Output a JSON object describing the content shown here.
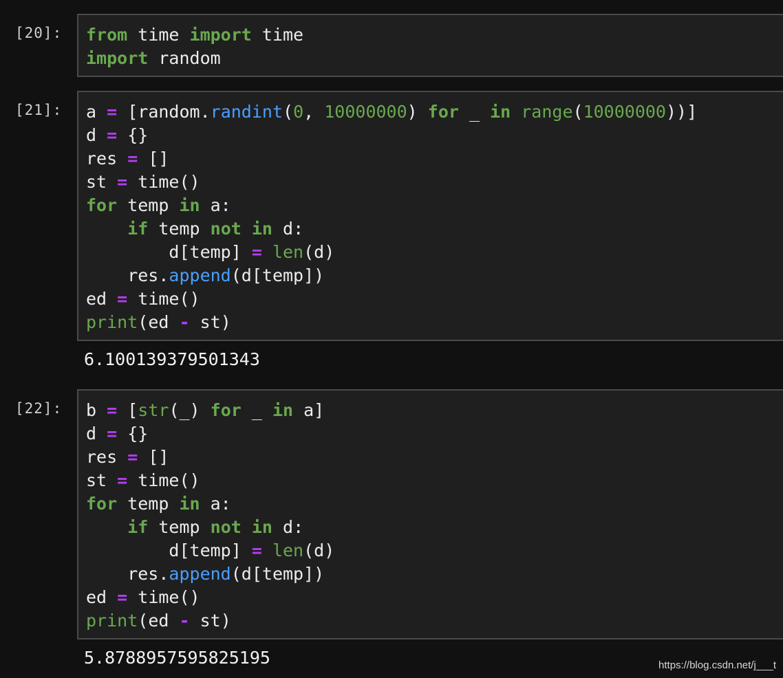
{
  "cells": [
    {
      "prompt": "[20]:",
      "lines": [
        [
          [
            "kw",
            "from"
          ],
          [
            "pl",
            " time "
          ],
          [
            "kw",
            "import"
          ],
          [
            "pl",
            " time"
          ]
        ],
        [
          [
            "kw",
            "import"
          ],
          [
            "pl",
            " random"
          ]
        ]
      ],
      "output": ""
    },
    {
      "prompt": "[21]:",
      "lines": [
        [
          [
            "pl",
            "a "
          ],
          [
            "op",
            "="
          ],
          [
            "pl",
            " [random."
          ],
          [
            "fn",
            "randint"
          ],
          [
            "pl",
            "("
          ],
          [
            "num",
            "0"
          ],
          [
            "pl",
            ", "
          ],
          [
            "num",
            "10000000"
          ],
          [
            "pl",
            ") "
          ],
          [
            "kw",
            "for"
          ],
          [
            "pl",
            " _ "
          ],
          [
            "kw",
            "in"
          ],
          [
            "pl",
            " "
          ],
          [
            "bi",
            "range"
          ],
          [
            "pl",
            "("
          ],
          [
            "num",
            "10000000"
          ],
          [
            "pl",
            "))]"
          ]
        ],
        [
          [
            "pl",
            "d "
          ],
          [
            "op",
            "="
          ],
          [
            "pl",
            " {}"
          ]
        ],
        [
          [
            "pl",
            "res "
          ],
          [
            "op",
            "="
          ],
          [
            "pl",
            " []"
          ]
        ],
        [
          [
            "pl",
            "st "
          ],
          [
            "op",
            "="
          ],
          [
            "pl",
            " time()"
          ]
        ],
        [
          [
            "kw",
            "for"
          ],
          [
            "pl",
            " temp "
          ],
          [
            "kw",
            "in"
          ],
          [
            "pl",
            " a:"
          ]
        ],
        [
          [
            "pl",
            "    "
          ],
          [
            "kw",
            "if"
          ],
          [
            "pl",
            " temp "
          ],
          [
            "kw",
            "not"
          ],
          [
            "pl",
            " "
          ],
          [
            "kw",
            "in"
          ],
          [
            "pl",
            " d:"
          ]
        ],
        [
          [
            "pl",
            "        d[temp] "
          ],
          [
            "op",
            "="
          ],
          [
            "pl",
            " "
          ],
          [
            "bi",
            "len"
          ],
          [
            "pl",
            "(d)"
          ]
        ],
        [
          [
            "pl",
            "    res."
          ],
          [
            "fn",
            "append"
          ],
          [
            "pl",
            "(d[temp])"
          ]
        ],
        [
          [
            "pl",
            "ed "
          ],
          [
            "op",
            "="
          ],
          [
            "pl",
            " time()"
          ]
        ],
        [
          [
            "bi",
            "print"
          ],
          [
            "pl",
            "(ed "
          ],
          [
            "op",
            "-"
          ],
          [
            "pl",
            " st)"
          ]
        ]
      ],
      "output": "6.100139379501343"
    },
    {
      "prompt": "[22]:",
      "lines": [
        [
          [
            "pl",
            "b "
          ],
          [
            "op",
            "="
          ],
          [
            "pl",
            " ["
          ],
          [
            "bi",
            "str"
          ],
          [
            "pl",
            "(_) "
          ],
          [
            "kw",
            "for"
          ],
          [
            "pl",
            " _ "
          ],
          [
            "kw",
            "in"
          ],
          [
            "pl",
            " a]"
          ]
        ],
        [
          [
            "pl",
            "d "
          ],
          [
            "op",
            "="
          ],
          [
            "pl",
            " {}"
          ]
        ],
        [
          [
            "pl",
            "res "
          ],
          [
            "op",
            "="
          ],
          [
            "pl",
            " []"
          ]
        ],
        [
          [
            "pl",
            "st "
          ],
          [
            "op",
            "="
          ],
          [
            "pl",
            " time()"
          ]
        ],
        [
          [
            "kw",
            "for"
          ],
          [
            "pl",
            " temp "
          ],
          [
            "kw",
            "in"
          ],
          [
            "pl",
            " a:"
          ]
        ],
        [
          [
            "pl",
            "    "
          ],
          [
            "kw",
            "if"
          ],
          [
            "pl",
            " temp "
          ],
          [
            "kw",
            "not"
          ],
          [
            "pl",
            " "
          ],
          [
            "kw",
            "in"
          ],
          [
            "pl",
            " d:"
          ]
        ],
        [
          [
            "pl",
            "        d[temp] "
          ],
          [
            "op",
            "="
          ],
          [
            "pl",
            " "
          ],
          [
            "bi",
            "len"
          ],
          [
            "pl",
            "(d)"
          ]
        ],
        [
          [
            "pl",
            "    res."
          ],
          [
            "fn",
            "append"
          ],
          [
            "pl",
            "(d[temp])"
          ]
        ],
        [
          [
            "pl",
            "ed "
          ],
          [
            "op",
            "="
          ],
          [
            "pl",
            " time()"
          ]
        ],
        [
          [
            "bi",
            "print"
          ],
          [
            "pl",
            "(ed "
          ],
          [
            "op",
            "-"
          ],
          [
            "pl",
            " st)"
          ]
        ]
      ],
      "output": "5.8788957595825195"
    }
  ],
  "watermark": "https://blog.csdn.net/j___t"
}
